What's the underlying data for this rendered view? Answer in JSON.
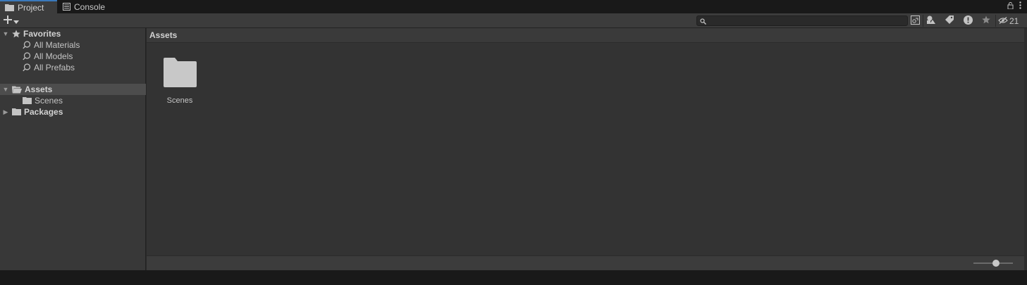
{
  "tabs": [
    {
      "label": "Project",
      "icon": "folder-icon",
      "active": true
    },
    {
      "label": "Console",
      "icon": "console-icon",
      "active": false
    }
  ],
  "toolbar": {
    "search": {
      "value": "",
      "placeholder": ""
    },
    "hidden_count": "21"
  },
  "tree": {
    "favorites": {
      "label": "Favorites",
      "items": [
        "All Materials",
        "All Models",
        "All Prefabs"
      ]
    },
    "assets": {
      "label": "Assets",
      "children": [
        "Scenes"
      ]
    },
    "packages": {
      "label": "Packages"
    }
  },
  "right": {
    "breadcrumb": "Assets",
    "items": [
      {
        "name": "Scenes",
        "type": "folder"
      }
    ],
    "icon_size_percent": 55
  },
  "colors": {
    "panel": "#383838",
    "content": "#333333",
    "selection": "#4d4d4d",
    "accent": "#3a79bb"
  }
}
